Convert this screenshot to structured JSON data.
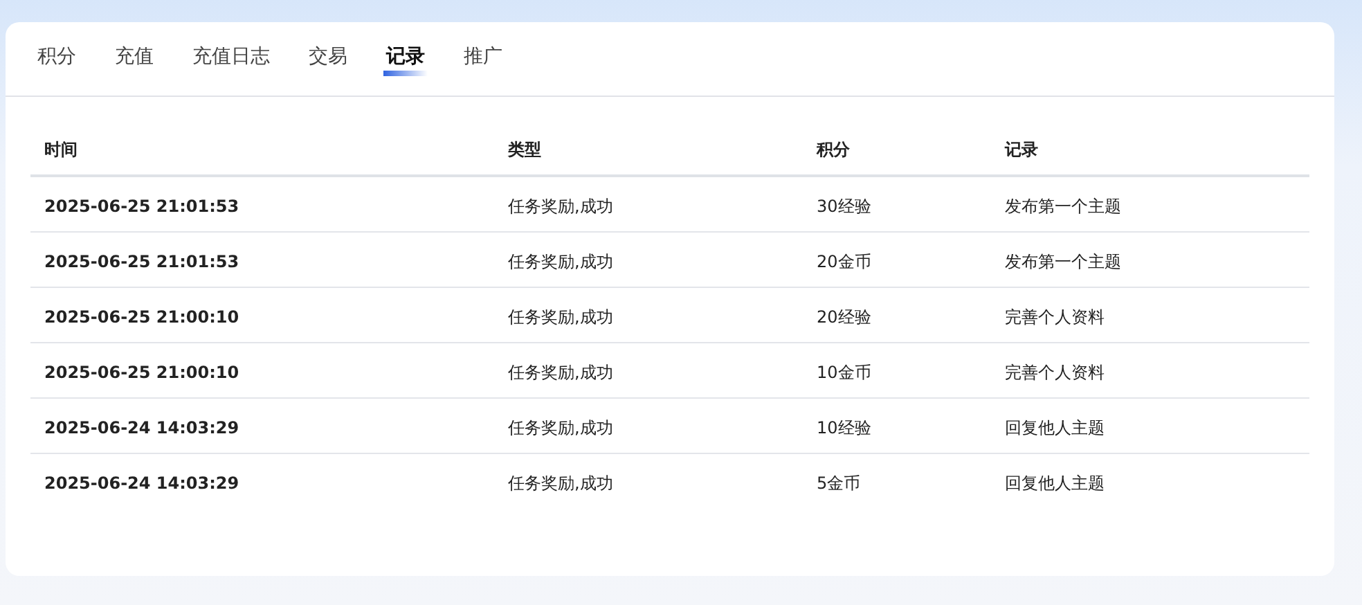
{
  "tabs": [
    {
      "label": "积分",
      "selected": false
    },
    {
      "label": "充值",
      "selected": false
    },
    {
      "label": "充值日志",
      "selected": false
    },
    {
      "label": "交易",
      "selected": false
    },
    {
      "label": "记录",
      "selected": true
    },
    {
      "label": "推广",
      "selected": false
    }
  ],
  "table": {
    "columns": [
      "时间",
      "类型",
      "积分",
      "记录"
    ],
    "rows": [
      [
        "2025-06-25 21:01:53",
        "任务奖励,成功",
        "30经验",
        "发布第一个主题"
      ],
      [
        "2025-06-25 21:01:53",
        "任务奖励,成功",
        "20金币",
        "发布第一个主题"
      ],
      [
        "2025-06-25 21:00:10",
        "任务奖励,成功",
        "20经验",
        "完善个人资料"
      ],
      [
        "2025-06-25 21:00:10",
        "任务奖励,成功",
        "10金币",
        "完善个人资料"
      ],
      [
        "2025-06-24 14:03:29",
        "任务奖励,成功",
        "10经验",
        "回复他人主题"
      ],
      [
        "2025-06-24 14:03:29",
        "任务奖励,成功",
        "5金币",
        "回复他人主题"
      ]
    ]
  }
}
